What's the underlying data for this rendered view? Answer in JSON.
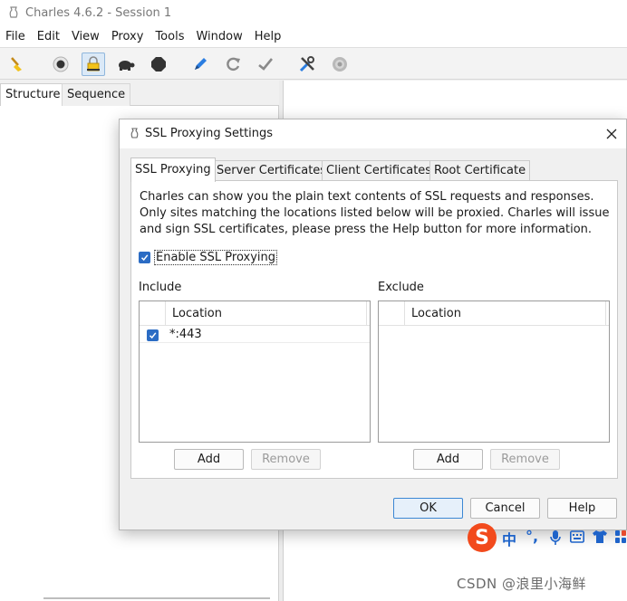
{
  "window": {
    "title": "Charles 4.6.2 - Session 1"
  },
  "menu": [
    "File",
    "Edit",
    "View",
    "Proxy",
    "Tools",
    "Window",
    "Help"
  ],
  "toolbar": {
    "icons": [
      "broom-icon",
      "record-icon",
      "ssl-lock-icon",
      "throttle-turtle-icon",
      "breakpoint-icon",
      "compose-pen-icon",
      "repeat-icon",
      "validate-check-icon",
      "tools-icon",
      "settings-gear-icon"
    ],
    "active": "ssl-lock-icon"
  },
  "left_tabs": [
    "Structure",
    "Sequence"
  ],
  "dialog": {
    "title": "SSL Proxying Settings",
    "tabs": [
      "SSL Proxying",
      "Server Certificates",
      "Client Certificates",
      "Root Certificate"
    ],
    "selected_tab": "SSL Proxying",
    "description": "Charles can show you the plain text contents of SSL requests and responses. Only sites matching the locations listed below will be proxied. Charles will issue and sign SSL certificates, please press the Help button for more information.",
    "enable_label": "Enable SSL Proxying",
    "enable_checked": true,
    "include": {
      "label": "Include",
      "column": "Location",
      "rows": [
        {
          "checked": true,
          "location": "*:443"
        }
      ],
      "add_label": "Add",
      "remove_label": "Remove"
    },
    "exclude": {
      "label": "Exclude",
      "column": "Location",
      "rows": [],
      "add_label": "Add",
      "remove_label": "Remove"
    },
    "buttons": {
      "ok": "OK",
      "cancel": "Cancel",
      "help": "Help"
    }
  },
  "ime": {
    "logo": "S",
    "items": [
      "中",
      "°,"
    ]
  },
  "watermark": "CSDN @浪里小海鲜",
  "colors": {
    "accent": "#2b6cc4",
    "ok_border": "#3b87d4",
    "ime_logo": "#f24a1c"
  }
}
